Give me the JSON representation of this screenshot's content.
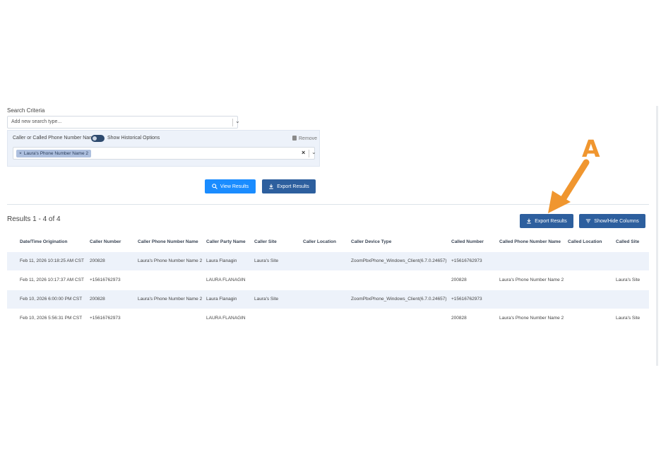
{
  "search": {
    "criteria_label": "Search Criteria",
    "add_placeholder": "Add new search type...",
    "criterion": {
      "label": "Caller or Called Phone Number Name",
      "historical_label": "Show Historical Options",
      "remove_label": "Remove",
      "chip_value": "Laura's Phone Number Name 2"
    }
  },
  "actions": {
    "view_results": "View Results",
    "export_results": "Export Results"
  },
  "results": {
    "count_label": "Results 1 - 4 of 4",
    "export_results": "Export Results",
    "show_hide_columns": "Show/Hide Columns",
    "columns": [
      "Date/Time Origination",
      "Caller Number",
      "Caller Phone Number Name",
      "Caller Party Name",
      "Caller Site",
      "Caller Location",
      "Caller Device Type",
      "Called Number",
      "Called Phone Number Name",
      "Called Location",
      "Called Site"
    ],
    "rows": [
      [
        "Feb 11, 2026 10:18:25 AM CST",
        "200828",
        "Laura's Phone Number Name 2",
        "Laura Flanagin",
        "Laura's Site",
        "",
        "ZoomPbxPhone_Windows_Client(6.7.0.24657)",
        "+15616762973",
        "",
        "",
        ""
      ],
      [
        "Feb 11, 2026 10:17:37 AM CST",
        "+15616762973",
        "",
        "LAURA FLANAGIN",
        "",
        "",
        "",
        "200828",
        "Laura's Phone Number Name 2",
        "",
        "Laura's Site"
      ],
      [
        "Feb 10, 2026 6:00:00 PM CST",
        "200828",
        "Laura's Phone Number Name 2",
        "Laura Flanagin",
        "Laura's Site",
        "",
        "ZoomPbxPhone_Windows_Client(6.7.0.24657)",
        "+15616762973",
        "",
        "",
        ""
      ],
      [
        "Feb 10, 2026 5:56:31 PM CST",
        "+15616762973",
        "",
        "LAURA FLANAGIN",
        "",
        "",
        "",
        "200828",
        "Laura's Phone Number Name 2",
        "",
        "Laura's Site"
      ]
    ]
  },
  "annotation": {
    "letter": "A",
    "color": "#f0962f"
  },
  "colors": {
    "primary": "#1a8cff",
    "secondary": "#2d5f9e",
    "row_alt": "#edf2fa"
  }
}
